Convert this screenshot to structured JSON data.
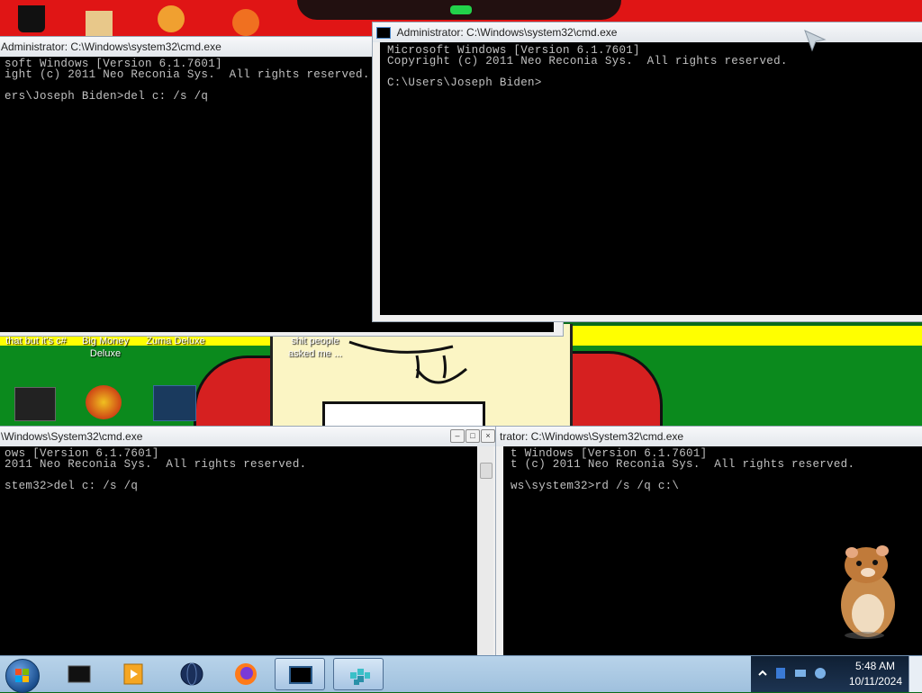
{
  "desktop": {
    "icons": [
      {
        "label": "that but it's c#"
      },
      {
        "label": "Big Money Deluxe"
      },
      {
        "label": "Zuma Deluxe"
      },
      {
        "label": "shit people asked me ..."
      }
    ]
  },
  "windows": {
    "top_left": {
      "title": "Administrator: C:\\Windows\\system32\\cmd.exe",
      "lines": [
        "soft Windows [Version 6.1.7601]",
        "ight (c) 2011 Neo Reconia Sys.  All rights reserved.",
        "",
        "ers\\Joseph Biden>del c: /s /q"
      ]
    },
    "top_right": {
      "title": "Administrator: C:\\Windows\\system32\\cmd.exe",
      "lines": [
        "Microsoft Windows [Version 6.1.7601]",
        "Copyright (c) 2011 Neo Reconia Sys.  All rights reserved.",
        "",
        "C:\\Users\\Joseph Biden>"
      ]
    },
    "bottom_left": {
      "title": "\\Windows\\System32\\cmd.exe",
      "lines": [
        "ows [Version 6.1.7601]",
        "2011 Neo Reconia Sys.  All rights reserved.",
        "",
        "stem32>del c: /s /q"
      ]
    },
    "bottom_right": {
      "title": "trator: C:\\Windows\\System32\\cmd.exe",
      "lines": [
        "t Windows [Version 6.1.7601]",
        "t (c) 2011 Neo Reconia Sys.  All rights reserved.",
        "",
        "ws\\system32>rd /s /q c:\\"
      ]
    }
  },
  "taskbar": {
    "items": [
      {
        "icon": "terminal-app-icon"
      },
      {
        "icon": "media-player-icon"
      },
      {
        "icon": "globe-icon"
      },
      {
        "icon": "firefox-icon"
      },
      {
        "icon": "cmd-icon",
        "active": true
      },
      {
        "icon": "network-blocks-icon",
        "active": true
      }
    ],
    "clock": {
      "time": "5:48 AM",
      "date": "10/11/2024"
    }
  },
  "colors": {
    "console_bg": "#000000",
    "console_text": "#c0c0c0",
    "wallpaper_red": "#e01515",
    "wallpaper_yellow": "#ffff00",
    "wallpaper_green": "#0b8a1d"
  }
}
